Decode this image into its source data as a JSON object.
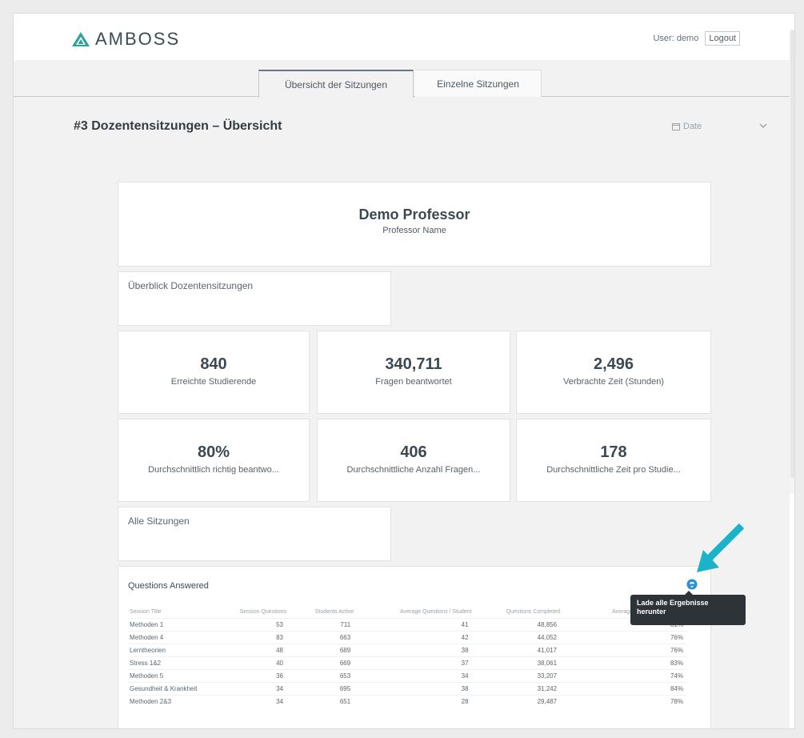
{
  "app": {
    "logo_text": "AMBOSS",
    "user_label": "User: demo",
    "logout_label": "Logout"
  },
  "tabs": [
    {
      "label": "Übersicht der Sitzungen",
      "active": true
    },
    {
      "label": "Einzelne Sitzungen",
      "active": false
    }
  ],
  "page": {
    "title": "#3 Dozentensitzungen – Übersicht",
    "date_filter_label": "Date"
  },
  "professor": {
    "name": "Demo Professor",
    "subtitle": "Professor Name"
  },
  "sections": {
    "overview": "Überblick Dozentensitzungen",
    "all_sessions": "Alle Sitzungen"
  },
  "kpis": [
    {
      "value": "840",
      "label": "Erreichte Studierende"
    },
    {
      "value": "340,711",
      "label": "Fragen beantwortet"
    },
    {
      "value": "2,496",
      "label": "Verbrachte Zeit (Stunden)"
    },
    {
      "value": "80%",
      "label": "Durchschnittlich richtig beantwo..."
    },
    {
      "value": "406",
      "label": "Durchschnittliche Anzahl Fragen..."
    },
    {
      "value": "178",
      "label": "Durchschnittliche Zeit pro Studie..."
    }
  ],
  "table": {
    "title": "Questions Answered",
    "columns": [
      "Session Title",
      "Session Questions",
      "Students Active",
      "Average Questions / Student",
      "Questions Completed",
      "Average Final Answer Correct"
    ],
    "rows": [
      [
        "Methoden 1",
        "53",
        "711",
        "41",
        "48,856",
        "81%"
      ],
      [
        "Methoden 4",
        "83",
        "663",
        "42",
        "44,052",
        "76%"
      ],
      [
        "Lerntheorien",
        "48",
        "689",
        "38",
        "41,017",
        "76%"
      ],
      [
        "Stress 1&2",
        "40",
        "669",
        "37",
        "38,061",
        "83%"
      ],
      [
        "Methoden 5",
        "36",
        "653",
        "34",
        "33,207",
        "74%"
      ],
      [
        "Gesundheit & Krankheit",
        "34",
        "695",
        "38",
        "31,242",
        "84%"
      ],
      [
        "Methoden 2&3",
        "34",
        "651",
        "28",
        "29,487",
        "78%"
      ]
    ]
  },
  "tooltip": {
    "text": "Lade alle Ergebnisse herunter"
  },
  "colors": {
    "accent": "#2a8fd3",
    "arrow": "#1bb3c9",
    "logo_teal": "#2fa39a"
  }
}
